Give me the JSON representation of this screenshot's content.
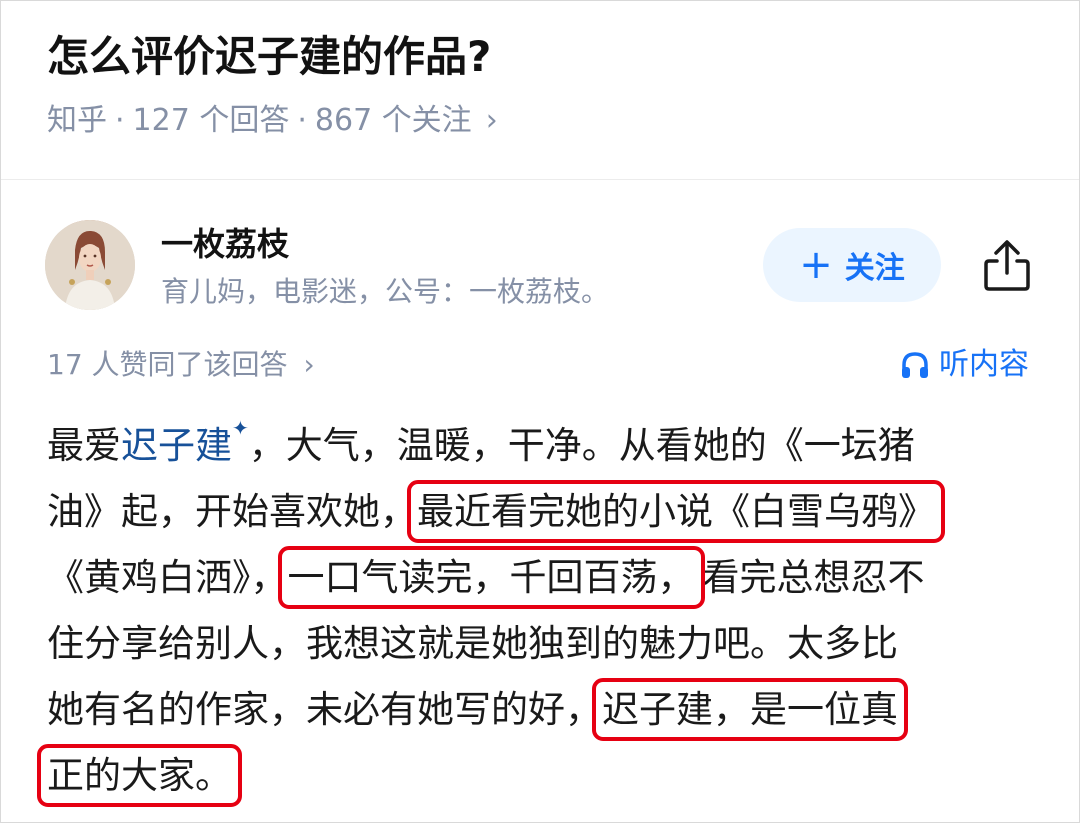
{
  "question": {
    "title": "怎么评价迟子建的作品?",
    "source": "知乎",
    "sep": "·",
    "answers": "127 个回答",
    "followers": "867 个关注",
    "chevron": "›"
  },
  "author": {
    "name": "一枚荔枝",
    "bio": "育儿妈，电影迷，公号：一枚荔枝。",
    "follow_plus": "+",
    "follow_label": "关注",
    "share_icon": "share-icon"
  },
  "answer": {
    "likes": "17 人赞同了该回答",
    "likes_chevron": "›",
    "listen_label": "听内容",
    "listen_icon": "headphones-icon",
    "line1_a": "最爱",
    "line1_link": "迟子建",
    "line1_link_mark": "✦",
    "line1_b": "，大气，温暖，干净。从看她的《一坛猪",
    "line2_a": "油》起，开始喜欢她，",
    "line2_hl": "最近看完她的小说《白雪乌鸦》",
    "line3_a": "《黄鸡白洒》，",
    "line3_hl": "一口气读完，千回百荡，",
    "line3_b": "看完总想忍不",
    "line4": "住分享给别人，我想这就是她独到的魅力吧。太多比",
    "line5_a": "她有名的作家，未必有她写的好，",
    "line5_hl": "迟子建，是一位真",
    "line6_hl": "正的大家。"
  },
  "colors": {
    "accent_blue": "#1772f6",
    "link_blue": "#175199",
    "highlight_red": "#e60012",
    "meta_gray": "#8590a6"
  }
}
